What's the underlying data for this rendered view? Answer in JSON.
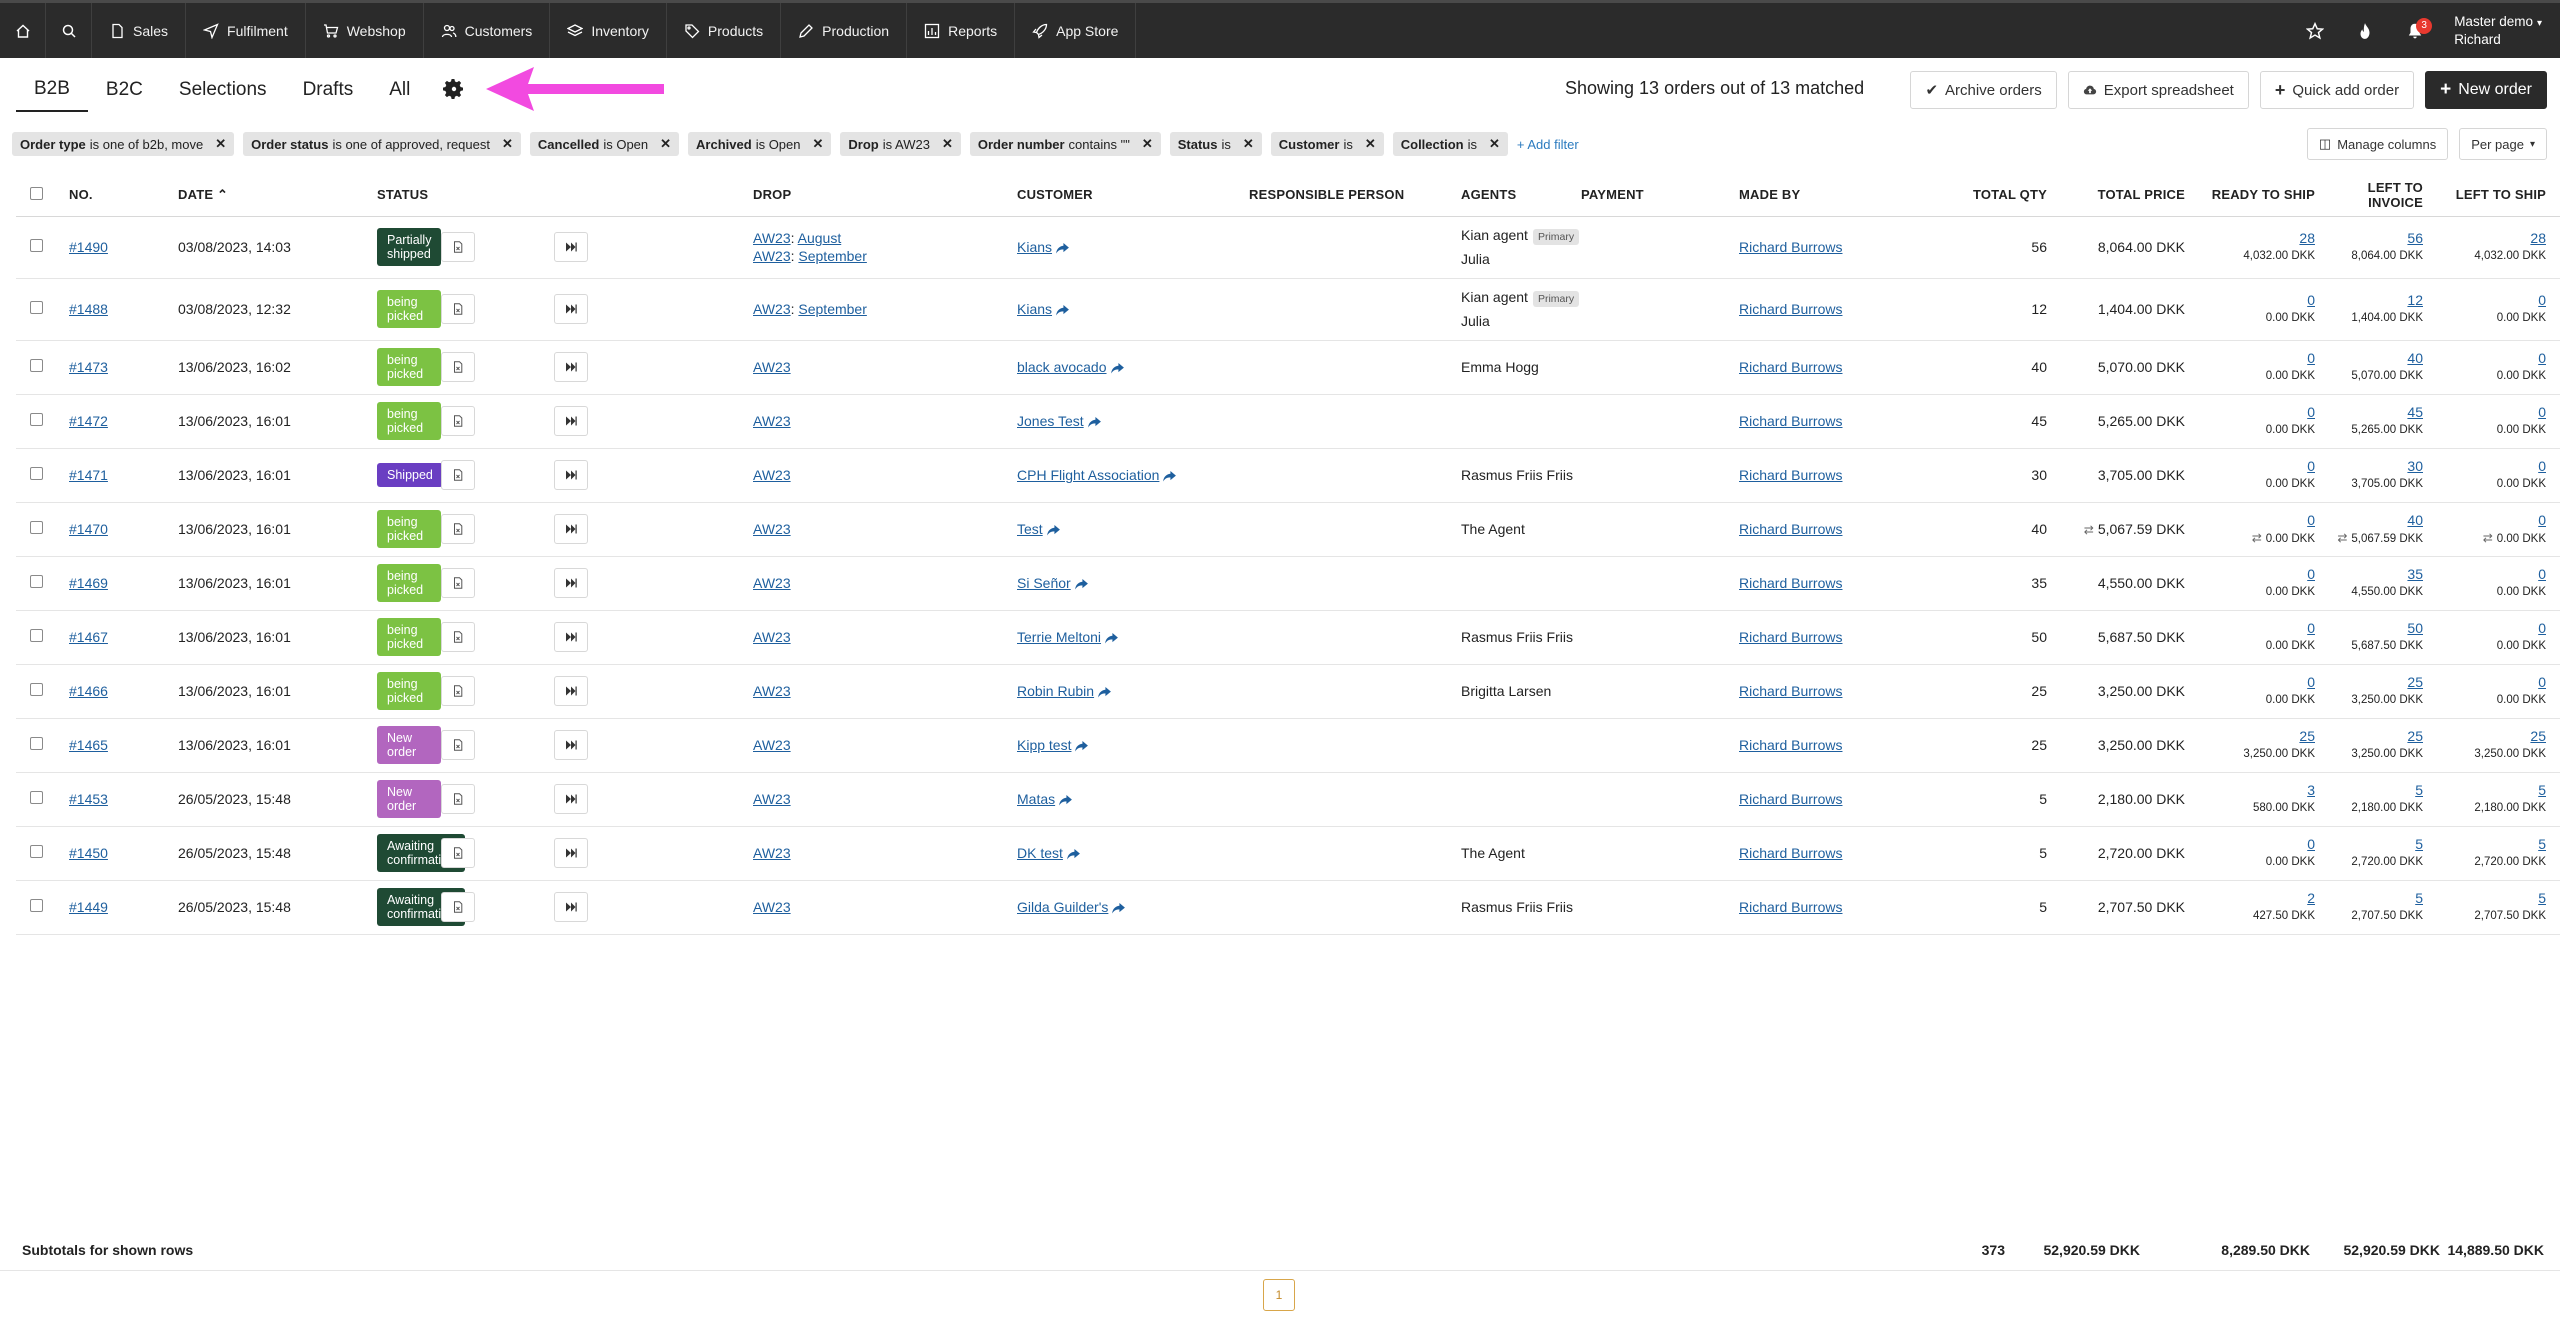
{
  "nav": {
    "items": [
      {
        "label": "Sales",
        "icon": "file-icon"
      },
      {
        "label": "Fulfilment",
        "icon": "send-icon"
      },
      {
        "label": "Webshop",
        "icon": "cart-icon"
      },
      {
        "label": "Customers",
        "icon": "users-icon"
      },
      {
        "label": "Inventory",
        "icon": "layers-icon"
      },
      {
        "label": "Products",
        "icon": "tag-icon"
      },
      {
        "label": "Production",
        "icon": "pencil-icon"
      },
      {
        "label": "Reports",
        "icon": "chart-icon"
      },
      {
        "label": "App Store",
        "icon": "rocket-icon"
      }
    ],
    "notification_count": "3",
    "user_line1": "Master demo",
    "user_line2": "Richard"
  },
  "tabs": [
    "B2B",
    "B2C",
    "Selections",
    "Drafts",
    "All"
  ],
  "showing_text": "Showing 13 orders out of 13 matched",
  "actions": {
    "archive": "Archive orders",
    "export": "Export spreadsheet",
    "quick_add": "Quick add order",
    "new_order": "New order"
  },
  "filters": [
    {
      "field": "Order type",
      "rest": "is one of b2b, move"
    },
    {
      "field": "Order status",
      "rest": "is one of approved, request"
    },
    {
      "field": "Cancelled",
      "rest": "is Open"
    },
    {
      "field": "Archived",
      "rest": "is Open"
    },
    {
      "field": "Drop",
      "rest": "is AW23"
    },
    {
      "field": "Order number",
      "rest": "contains \"\""
    },
    {
      "field": "Status",
      "rest": "is"
    },
    {
      "field": "Customer",
      "rest": "is"
    },
    {
      "field": "Collection",
      "rest": "is"
    }
  ],
  "add_filter": "Add filter",
  "manage_columns": "Manage columns",
  "per_page": "Per page",
  "columns": {
    "no": "No.",
    "date": "Date",
    "status": "Status",
    "drop": "Drop",
    "customer": "Customer",
    "responsible": "Responsible person",
    "agents": "Agents",
    "payment": "Payment",
    "made_by": "Made by",
    "total_qty": "Total qty",
    "total_price": "Total price",
    "ready_to_ship": "Ready to ship",
    "left_to_invoice": "Left to invoice",
    "left_to_ship": "Left to ship"
  },
  "colors": {
    "partially_shipped": "#1f4a34",
    "being_picked": "#7cc243",
    "shipped": "#6a3ec2",
    "new_order": "#b266bf",
    "awaiting_confirmation": "#1f4a34"
  },
  "orders": [
    {
      "no": "#1490",
      "date": "03/08/2023, 14:03",
      "status": "Partially shipped",
      "status_color": "#1f4a34",
      "drop": [
        {
          "code": "AW23",
          "sub": "August"
        },
        {
          "code": "AW23",
          "sub": "September"
        }
      ],
      "customer": "Kians",
      "agents": [
        {
          "name": "Kian agent",
          "tag": "Primary"
        },
        {
          "name": "Julia",
          "tag": ""
        }
      ],
      "made_by": "Richard Burrows",
      "qty": "56",
      "price": "8,064.00 DKK",
      "rts": "28",
      "rts_amt": "4,032.00 DKK",
      "lti": "56",
      "lti_amt": "8,064.00 DKK",
      "lts": "28",
      "lts_amt": "4,032.00 DKK",
      "tall": true
    },
    {
      "no": "#1488",
      "date": "03/08/2023, 12:32",
      "status": "being picked",
      "status_color": "#7cc243",
      "drop": [
        {
          "code": "AW23",
          "sub": "September"
        }
      ],
      "customer": "Kians",
      "agents": [
        {
          "name": "Kian agent",
          "tag": "Primary"
        },
        {
          "name": "Julia",
          "tag": ""
        }
      ],
      "made_by": "Richard Burrows",
      "qty": "12",
      "price": "1,404.00 DKK",
      "rts": "0",
      "rts_amt": "0.00 DKK",
      "lti": "12",
      "lti_amt": "1,404.00 DKK",
      "lts": "0",
      "lts_amt": "0.00 DKK",
      "tall": true
    },
    {
      "no": "#1473",
      "date": "13/06/2023, 16:02",
      "status": "being picked",
      "status_color": "#7cc243",
      "drop": [
        {
          "code": "AW23",
          "sub": ""
        }
      ],
      "customer": "black avocado",
      "agents": [
        {
          "name": "Emma Hogg",
          "tag": ""
        }
      ],
      "made_by": "Richard Burrows",
      "qty": "40",
      "price": "5,070.00 DKK",
      "rts": "0",
      "rts_amt": "0.00 DKK",
      "lti": "40",
      "lti_amt": "5,070.00 DKK",
      "lts": "0",
      "lts_amt": "0.00 DKK"
    },
    {
      "no": "#1472",
      "date": "13/06/2023, 16:01",
      "status": "being picked",
      "status_color": "#7cc243",
      "drop": [
        {
          "code": "AW23",
          "sub": ""
        }
      ],
      "customer": "Jones Test",
      "agents": [],
      "made_by": "Richard Burrows",
      "qty": "45",
      "price": "5,265.00 DKK",
      "rts": "0",
      "rts_amt": "0.00 DKK",
      "lti": "45",
      "lti_amt": "5,265.00 DKK",
      "lts": "0",
      "lts_amt": "0.00 DKK"
    },
    {
      "no": "#1471",
      "date": "13/06/2023, 16:01",
      "status": "Shipped",
      "status_color": "#6a3ec2",
      "drop": [
        {
          "code": "AW23",
          "sub": ""
        }
      ],
      "customer": "CPH Flight Association",
      "agents": [
        {
          "name": "Rasmus Friis Friis",
          "tag": ""
        }
      ],
      "made_by": "Richard Burrows",
      "qty": "30",
      "price": "3,705.00 DKK",
      "rts": "0",
      "rts_amt": "0.00 DKK",
      "lti": "30",
      "lti_amt": "3,705.00 DKK",
      "lts": "0",
      "lts_amt": "0.00 DKK"
    },
    {
      "no": "#1470",
      "date": "13/06/2023, 16:01",
      "status": "being picked",
      "status_color": "#7cc243",
      "drop": [
        {
          "code": "AW23",
          "sub": ""
        }
      ],
      "customer": "Test",
      "agents": [
        {
          "name": "The Agent",
          "tag": ""
        }
      ],
      "made_by": "Richard Burrows",
      "qty": "40",
      "price": "5,067.59 DKK",
      "fx": true,
      "rts": "0",
      "rts_amt": "0.00 DKK",
      "lti": "40",
      "lti_amt": "5,067.59 DKK",
      "lts": "0",
      "lts_amt": "0.00 DKK"
    },
    {
      "no": "#1469",
      "date": "13/06/2023, 16:01",
      "status": "being picked",
      "status_color": "#7cc243",
      "drop": [
        {
          "code": "AW23",
          "sub": ""
        }
      ],
      "customer": "Si Señor",
      "agents": [],
      "made_by": "Richard Burrows",
      "qty": "35",
      "price": "4,550.00 DKK",
      "rts": "0",
      "rts_amt": "0.00 DKK",
      "lti": "35",
      "lti_amt": "4,550.00 DKK",
      "lts": "0",
      "lts_amt": "0.00 DKK"
    },
    {
      "no": "#1467",
      "date": "13/06/2023, 16:01",
      "status": "being picked",
      "status_color": "#7cc243",
      "drop": [
        {
          "code": "AW23",
          "sub": ""
        }
      ],
      "customer": "Terrie Meltoni",
      "agents": [
        {
          "name": "Rasmus Friis Friis",
          "tag": ""
        }
      ],
      "made_by": "Richard Burrows",
      "qty": "50",
      "price": "5,687.50 DKK",
      "rts": "0",
      "rts_amt": "0.00 DKK",
      "lti": "50",
      "lti_amt": "5,687.50 DKK",
      "lts": "0",
      "lts_amt": "0.00 DKK"
    },
    {
      "no": "#1466",
      "date": "13/06/2023, 16:01",
      "status": "being picked",
      "status_color": "#7cc243",
      "drop": [
        {
          "code": "AW23",
          "sub": ""
        }
      ],
      "customer": "Robin Rubin",
      "agents": [
        {
          "name": "Brigitta Larsen",
          "tag": ""
        }
      ],
      "made_by": "Richard Burrows",
      "qty": "25",
      "price": "3,250.00 DKK",
      "rts": "0",
      "rts_amt": "0.00 DKK",
      "lti": "25",
      "lti_amt": "3,250.00 DKK",
      "lts": "0",
      "lts_amt": "0.00 DKK"
    },
    {
      "no": "#1465",
      "date": "13/06/2023, 16:01",
      "status": "New order",
      "status_color": "#b266bf",
      "drop": [
        {
          "code": "AW23",
          "sub": ""
        }
      ],
      "customer": "Kipp test",
      "agents": [],
      "made_by": "Richard Burrows",
      "qty": "25",
      "price": "3,250.00 DKK",
      "rts": "25",
      "rts_amt": "3,250.00 DKK",
      "lti": "25",
      "lti_amt": "3,250.00 DKK",
      "lts": "25",
      "lts_amt": "3,250.00 DKK"
    },
    {
      "no": "#1453",
      "date": "26/05/2023, 15:48",
      "status": "New order",
      "status_color": "#b266bf",
      "drop": [
        {
          "code": "AW23",
          "sub": ""
        }
      ],
      "customer": "Matas",
      "agents": [],
      "made_by": "Richard Burrows",
      "qty": "5",
      "price": "2,180.00 DKK",
      "rts": "3",
      "rts_amt": "580.00 DKK",
      "lti": "5",
      "lti_amt": "2,180.00 DKK",
      "lts": "5",
      "lts_amt": "2,180.00 DKK"
    },
    {
      "no": "#1450",
      "date": "26/05/2023, 15:48",
      "status": "Awaiting confirmation",
      "status_color": "#1f4a34",
      "drop": [
        {
          "code": "AW23",
          "sub": ""
        }
      ],
      "customer": "DK test",
      "agents": [
        {
          "name": "The Agent",
          "tag": ""
        }
      ],
      "made_by": "Richard Burrows",
      "qty": "5",
      "price": "2,720.00 DKK",
      "rts": "0",
      "rts_amt": "0.00 DKK",
      "lti": "5",
      "lti_amt": "2,720.00 DKK",
      "lts": "5",
      "lts_amt": "2,720.00 DKK"
    },
    {
      "no": "#1449",
      "date": "26/05/2023, 15:48",
      "status": "Awaiting confirmation",
      "status_color": "#1f4a34",
      "drop": [
        {
          "code": "AW23",
          "sub": ""
        }
      ],
      "customer": "Gilda Guilder's",
      "agents": [
        {
          "name": "Rasmus Friis Friis",
          "tag": ""
        }
      ],
      "made_by": "Richard Burrows",
      "qty": "5",
      "price": "2,707.50 DKK",
      "rts": "2",
      "rts_amt": "427.50 DKK",
      "lti": "5",
      "lti_amt": "2,707.50 DKK",
      "lts": "5",
      "lts_amt": "2,707.50 DKK"
    }
  ],
  "subtotals": {
    "label": "Subtotals for shown rows",
    "qty": "373",
    "price": "52,920.59 DKK",
    "rts": "8,289.50 DKK",
    "lti": "52,920.59 DKK",
    "lts": "14,889.50 DKK"
  },
  "pager": {
    "current": "1"
  }
}
